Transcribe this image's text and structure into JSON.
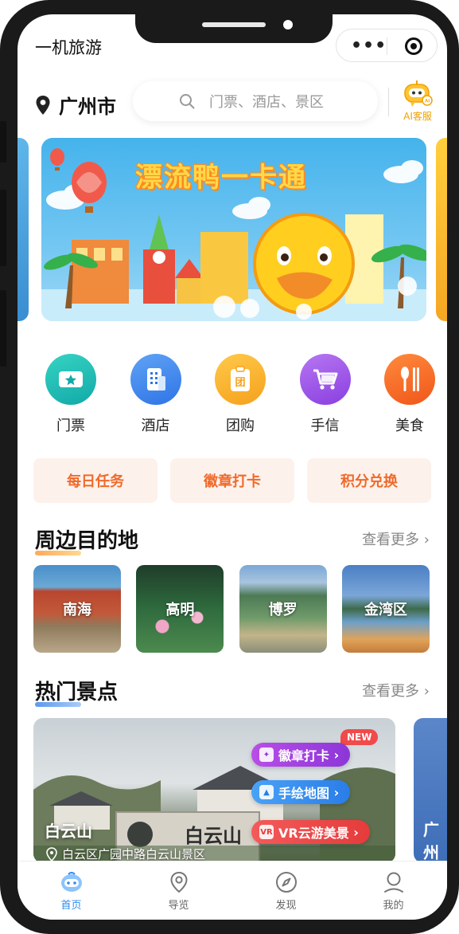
{
  "app": {
    "title": "一机旅游"
  },
  "header": {
    "location": "广州市",
    "search_placeholder": "门票、酒店、景区",
    "ai_label": "AI客服"
  },
  "banner": {
    "title": "漂流鸭一卡通"
  },
  "categories": [
    {
      "label": "门票",
      "icon": "ticket-icon",
      "color": "#1fb8b3"
    },
    {
      "label": "酒店",
      "icon": "hotel-icon",
      "color": "#3e86ec"
    },
    {
      "label": "团购",
      "icon": "group-buy-icon",
      "color": "#f7b021"
    },
    {
      "label": "手信",
      "icon": "cart-icon",
      "color": "#9b52e6"
    },
    {
      "label": "美食",
      "icon": "food-icon",
      "color": "#f66a1f"
    }
  ],
  "tasks": [
    {
      "label": "每日任务"
    },
    {
      "label": "徽章打卡"
    },
    {
      "label": "积分兑换"
    }
  ],
  "nearby": {
    "title": "周边目的地",
    "more": "查看更多",
    "items": [
      {
        "name": "南海"
      },
      {
        "name": "高明"
      },
      {
        "name": "博罗"
      },
      {
        "name": "金湾区"
      }
    ]
  },
  "hot": {
    "title": "热门景点",
    "more": "查看更多",
    "spot": {
      "name": "白云山",
      "address": "白云区广园中路白云山景区",
      "sign_text": "白云山",
      "badge": "NEW",
      "actions": [
        {
          "label": "徽章打卡",
          "color": "#a93be0"
        },
        {
          "label": "手绘地图",
          "color": "#2f8af0"
        },
        {
          "label": "VR云游美景",
          "color": "#f24a4a"
        }
      ]
    },
    "peek_name": "广州"
  },
  "tabbar": [
    {
      "label": "首页",
      "icon": "home-icon",
      "active": true
    },
    {
      "label": "导览",
      "icon": "location-pin-icon",
      "active": false
    },
    {
      "label": "发现",
      "icon": "compass-icon",
      "active": false
    },
    {
      "label": "我的",
      "icon": "user-icon",
      "active": false
    }
  ],
  "colors": {
    "accent": "#2c8cf0",
    "task_text": "#ef6a2a",
    "task_bg": "#fdf1ec",
    "ai_color": "#f0a100"
  }
}
